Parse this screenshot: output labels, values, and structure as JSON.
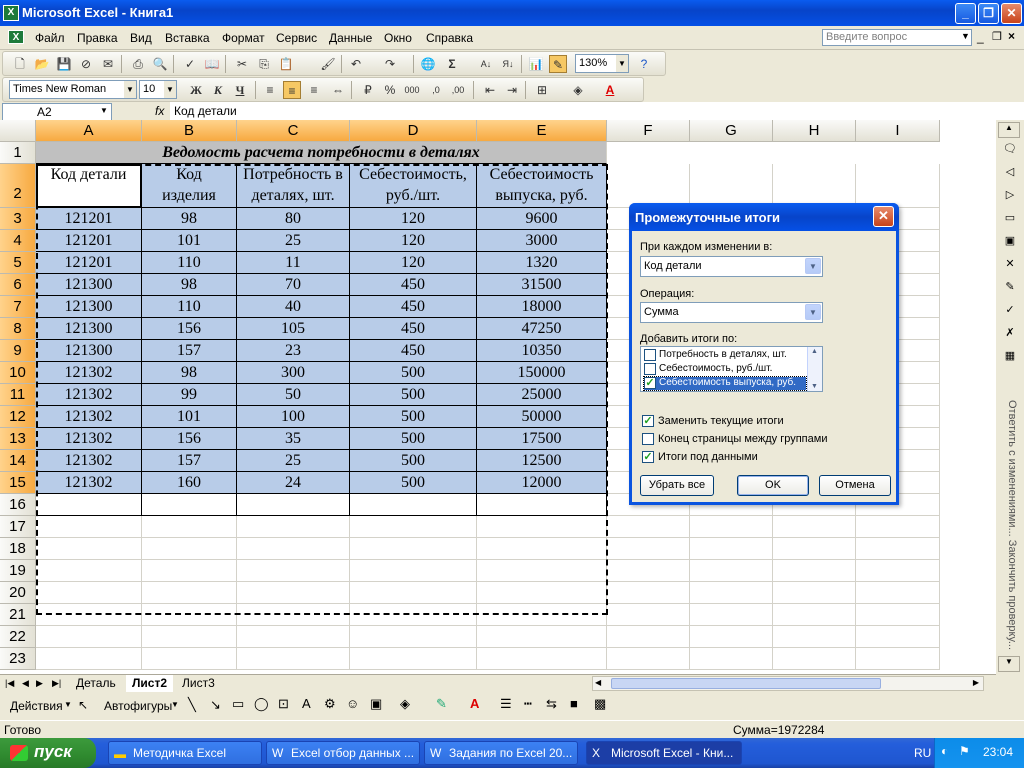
{
  "window": {
    "title": "Microsoft Excel - Книга1"
  },
  "menu": {
    "items": [
      "Файл",
      "Правка",
      "Вид",
      "Вставка",
      "Формат",
      "Сервис",
      "Данные",
      "Окно",
      "Справка"
    ],
    "ask_placeholder": "Введите вопрос"
  },
  "toolbar": {
    "zoom": "130%",
    "font_name": "Times New Roman",
    "font_size": "10"
  },
  "formula_bar": {
    "cell_ref": "A2",
    "fx": "fx",
    "value": "Код  детали"
  },
  "sheet": {
    "columns": [
      "A",
      "B",
      "C",
      "D",
      "E",
      "F",
      "G",
      "H",
      "I"
    ],
    "rows": [
      "1",
      "2",
      "3",
      "4",
      "5",
      "6",
      "7",
      "8",
      "9",
      "10",
      "11",
      "12",
      "13",
      "14",
      "15",
      "16",
      "17",
      "18",
      "19",
      "20",
      "21",
      "22",
      "23"
    ],
    "title": "Ведомость расчета потребности в деталях",
    "headers": [
      [
        "Код  детали",
        ""
      ],
      [
        "Код",
        "изделия"
      ],
      [
        "Потребность в",
        "деталях, шт."
      ],
      [
        "Себестоимость,",
        "руб./шт."
      ],
      [
        "Себестоимость",
        "выпуска, руб."
      ]
    ],
    "data": [
      [
        "121201",
        "98",
        "80",
        "120",
        "9600"
      ],
      [
        "121201",
        "101",
        "25",
        "120",
        "3000"
      ],
      [
        "121201",
        "110",
        "11",
        "120",
        "1320"
      ],
      [
        "121300",
        "98",
        "70",
        "450",
        "31500"
      ],
      [
        "121300",
        "110",
        "40",
        "450",
        "18000"
      ],
      [
        "121300",
        "156",
        "105",
        "450",
        "47250"
      ],
      [
        "121300",
        "157",
        "23",
        "450",
        "10350"
      ],
      [
        "121302",
        "98",
        "300",
        "500",
        "150000"
      ],
      [
        "121302",
        "99",
        "50",
        "500",
        "25000"
      ],
      [
        "121302",
        "101",
        "100",
        "500",
        "50000"
      ],
      [
        "121302",
        "156",
        "35",
        "500",
        "17500"
      ],
      [
        "121302",
        "157",
        "25",
        "500",
        "12500"
      ],
      [
        "121302",
        "160",
        "24",
        "500",
        "12000"
      ]
    ]
  },
  "tabs": [
    "Деталь",
    "Лист2",
    "Лист3"
  ],
  "active_tab": "Лист2",
  "drawing": {
    "actions": "Действия",
    "autoshapes": "Автофигуры"
  },
  "status": {
    "ready": "Готово",
    "sum": "Сумма=1972284"
  },
  "dialog": {
    "title": "Промежуточные итоги",
    "group_label": "При каждом изменении в:",
    "group_value": "Код  детали",
    "op_label": "Операция:",
    "op_value": "Сумма",
    "add_label": "Добавить итоги по:",
    "add_items": [
      "Потребность в деталях, шт.",
      "Себестоимость, руб./шт.",
      "Себестоимость выпуска, руб."
    ],
    "add_checked": [
      false,
      false,
      true
    ],
    "opt_replace": "Заменить текущие итоги",
    "opt_pagebreak": "Конец страницы между группами",
    "opt_below": "Итоги под данными",
    "opt_checked": [
      true,
      false,
      true
    ],
    "btn_remove": "Убрать все",
    "btn_ok": "OK",
    "btn_cancel": "Отмена"
  },
  "side_pane": {
    "text": "Ответить с изменениями... Закончить проверку..."
  },
  "taskbar": {
    "start": "пуск",
    "items": [
      "Методичка Excel",
      "Excel отбор данных ...",
      "Задания по Excel 20...",
      "Microsoft Excel - Кни..."
    ],
    "lang": "RU",
    "clock": "23:04"
  }
}
